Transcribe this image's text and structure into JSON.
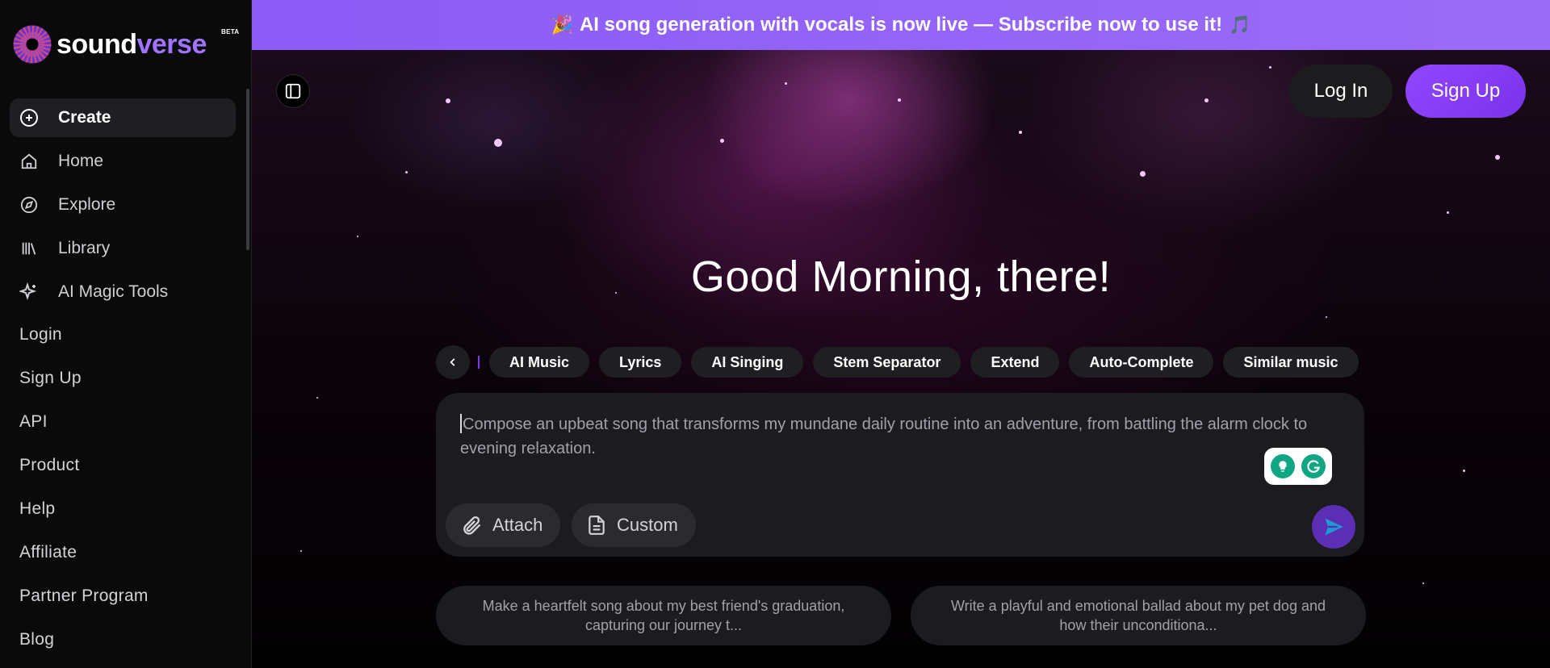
{
  "brand": {
    "name_part1": "sound",
    "name_part2": "verse",
    "badge": "BETA"
  },
  "sidebar": {
    "nav": [
      {
        "label": "Create",
        "icon": "plus-circle-icon",
        "active": true
      },
      {
        "label": "Home",
        "icon": "home-icon",
        "active": false
      },
      {
        "label": "Explore",
        "icon": "compass-icon",
        "active": false
      },
      {
        "label": "Library",
        "icon": "library-icon",
        "active": false
      },
      {
        "label": "AI Magic Tools",
        "icon": "sparkles-icon",
        "active": false
      }
    ],
    "links": [
      "Login",
      "Sign Up",
      "API",
      "Product",
      "Help",
      "Affiliate",
      "Partner Program",
      "Blog"
    ]
  },
  "banner": {
    "emoji_left": "🎉",
    "text": "AI song generation with vocals is now live — Subscribe now to use it!",
    "emoji_right": "🎵"
  },
  "header": {
    "login_label": "Log In",
    "signup_label": "Sign Up"
  },
  "greeting": "Good Morning, there!",
  "chips": [
    "AI Music",
    "Lyrics",
    "AI Singing",
    "Stem Separator",
    "Extend",
    "Auto-Complete",
    "Similar music"
  ],
  "prompt": {
    "text": "Compose an upbeat song that transforms my mundane daily routine into an adventure, from battling the alarm clock to evening relaxation.",
    "attach_label": "Attach",
    "custom_label": "Custom"
  },
  "suggestions": [
    "Make a heartfelt song about my best friend's graduation, capturing our journey t...",
    "Write a playful and emotional ballad about my pet dog and how their unconditiona..."
  ],
  "colors": {
    "banner": "#8b5cf6",
    "accent": "#a073ff",
    "signup": "#9146ff"
  }
}
